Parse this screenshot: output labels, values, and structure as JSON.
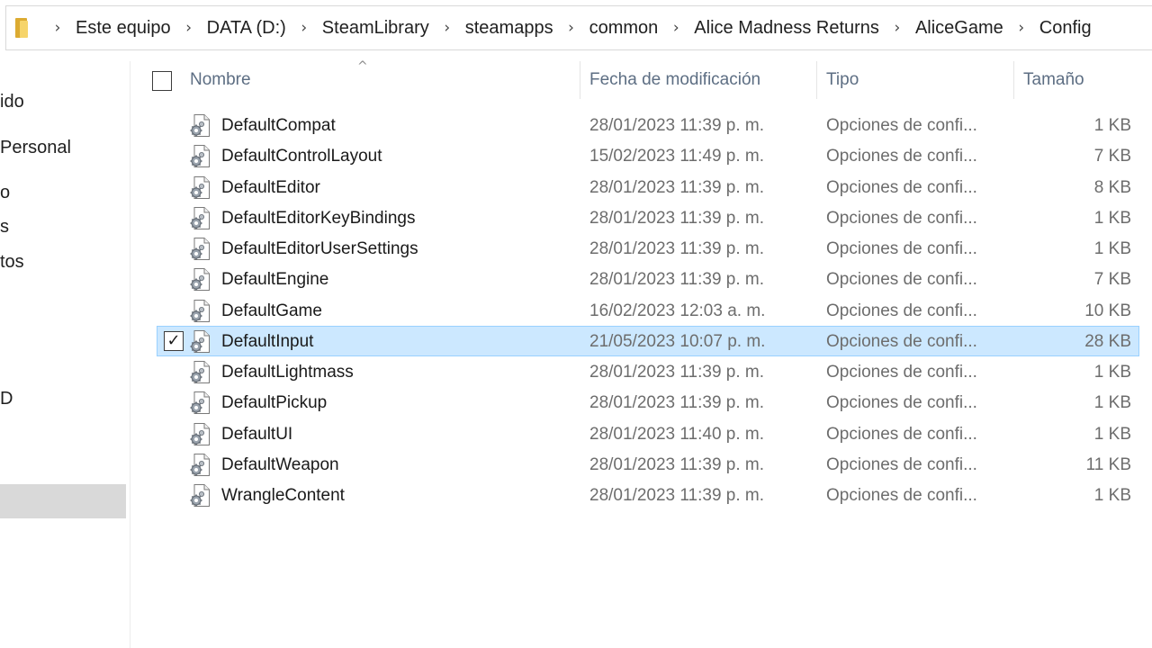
{
  "address_bar": {
    "folder_icon": "folder-icon",
    "crumbs": [
      "Este equipo",
      "DATA (D:)",
      "SteamLibrary",
      "steamapps",
      "common",
      "Alice Madness Returns",
      "AliceGame",
      "Config"
    ]
  },
  "nav": {
    "items": [
      "ido",
      " Personal",
      "o",
      "s",
      "tos",
      "D"
    ]
  },
  "columns": {
    "name": "Nombre",
    "date": "Fecha de modificación",
    "type": "Tipo",
    "size": "Tamaño"
  },
  "files": [
    {
      "name": "DefaultCompat",
      "date": "28/01/2023 11:39 p. m.",
      "type": "Opciones de confi...",
      "size": "1 KB",
      "selected": false
    },
    {
      "name": "DefaultControlLayout",
      "date": "15/02/2023 11:49 p. m.",
      "type": "Opciones de confi...",
      "size": "7 KB",
      "selected": false
    },
    {
      "name": "DefaultEditor",
      "date": "28/01/2023 11:39 p. m.",
      "type": "Opciones de confi...",
      "size": "8 KB",
      "selected": false
    },
    {
      "name": "DefaultEditorKeyBindings",
      "date": "28/01/2023 11:39 p. m.",
      "type": "Opciones de confi...",
      "size": "1 KB",
      "selected": false
    },
    {
      "name": "DefaultEditorUserSettings",
      "date": "28/01/2023 11:39 p. m.",
      "type": "Opciones de confi...",
      "size": "1 KB",
      "selected": false
    },
    {
      "name": "DefaultEngine",
      "date": "28/01/2023 11:39 p. m.",
      "type": "Opciones de confi...",
      "size": "7 KB",
      "selected": false
    },
    {
      "name": "DefaultGame",
      "date": "16/02/2023 12:03 a. m.",
      "type": "Opciones de confi...",
      "size": "10 KB",
      "selected": false
    },
    {
      "name": "DefaultInput",
      "date": "21/05/2023 10:07 p. m.",
      "type": "Opciones de confi...",
      "size": "28 KB",
      "selected": true
    },
    {
      "name": "DefaultLightmass",
      "date": "28/01/2023 11:39 p. m.",
      "type": "Opciones de confi...",
      "size": "1 KB",
      "selected": false
    },
    {
      "name": "DefaultPickup",
      "date": "28/01/2023 11:39 p. m.",
      "type": "Opciones de confi...",
      "size": "1 KB",
      "selected": false
    },
    {
      "name": "DefaultUI",
      "date": "28/01/2023 11:40 p. m.",
      "type": "Opciones de confi...",
      "size": "1 KB",
      "selected": false
    },
    {
      "name": "DefaultWeapon",
      "date": "28/01/2023 11:39 p. m.",
      "type": "Opciones de confi...",
      "size": "11 KB",
      "selected": false
    },
    {
      "name": "WrangleContent",
      "date": "28/01/2023 11:39 p. m.",
      "type": "Opciones de confi...",
      "size": "1 KB",
      "selected": false
    }
  ],
  "colors": {
    "selection_bg": "#cce8ff",
    "selection_border": "#99d1ff",
    "header_text": "#5d6e83",
    "secondary_text": "#6d6d6d"
  }
}
